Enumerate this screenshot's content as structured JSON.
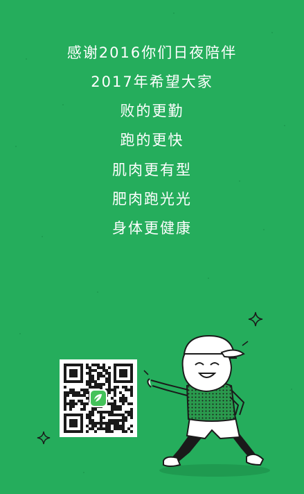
{
  "poster": {
    "lines": [
      "感谢2016你们日夜陪伴",
      "2017年希望大家",
      "败的更勤",
      "跑的更快",
      "肌肉更有型",
      "肥肉跑光光",
      "身体更健康"
    ],
    "colors": {
      "background": "#25ad5c",
      "text": "#ffffff",
      "outline": "#1a1a1a",
      "qr_logo": "#44c25a"
    },
    "decorations": [
      "sparkle-icon",
      "sparkle-icon"
    ],
    "qr_code": {
      "center_icon": "app-logo-icon"
    },
    "illustration": "cartoon-runner-in-cap"
  }
}
